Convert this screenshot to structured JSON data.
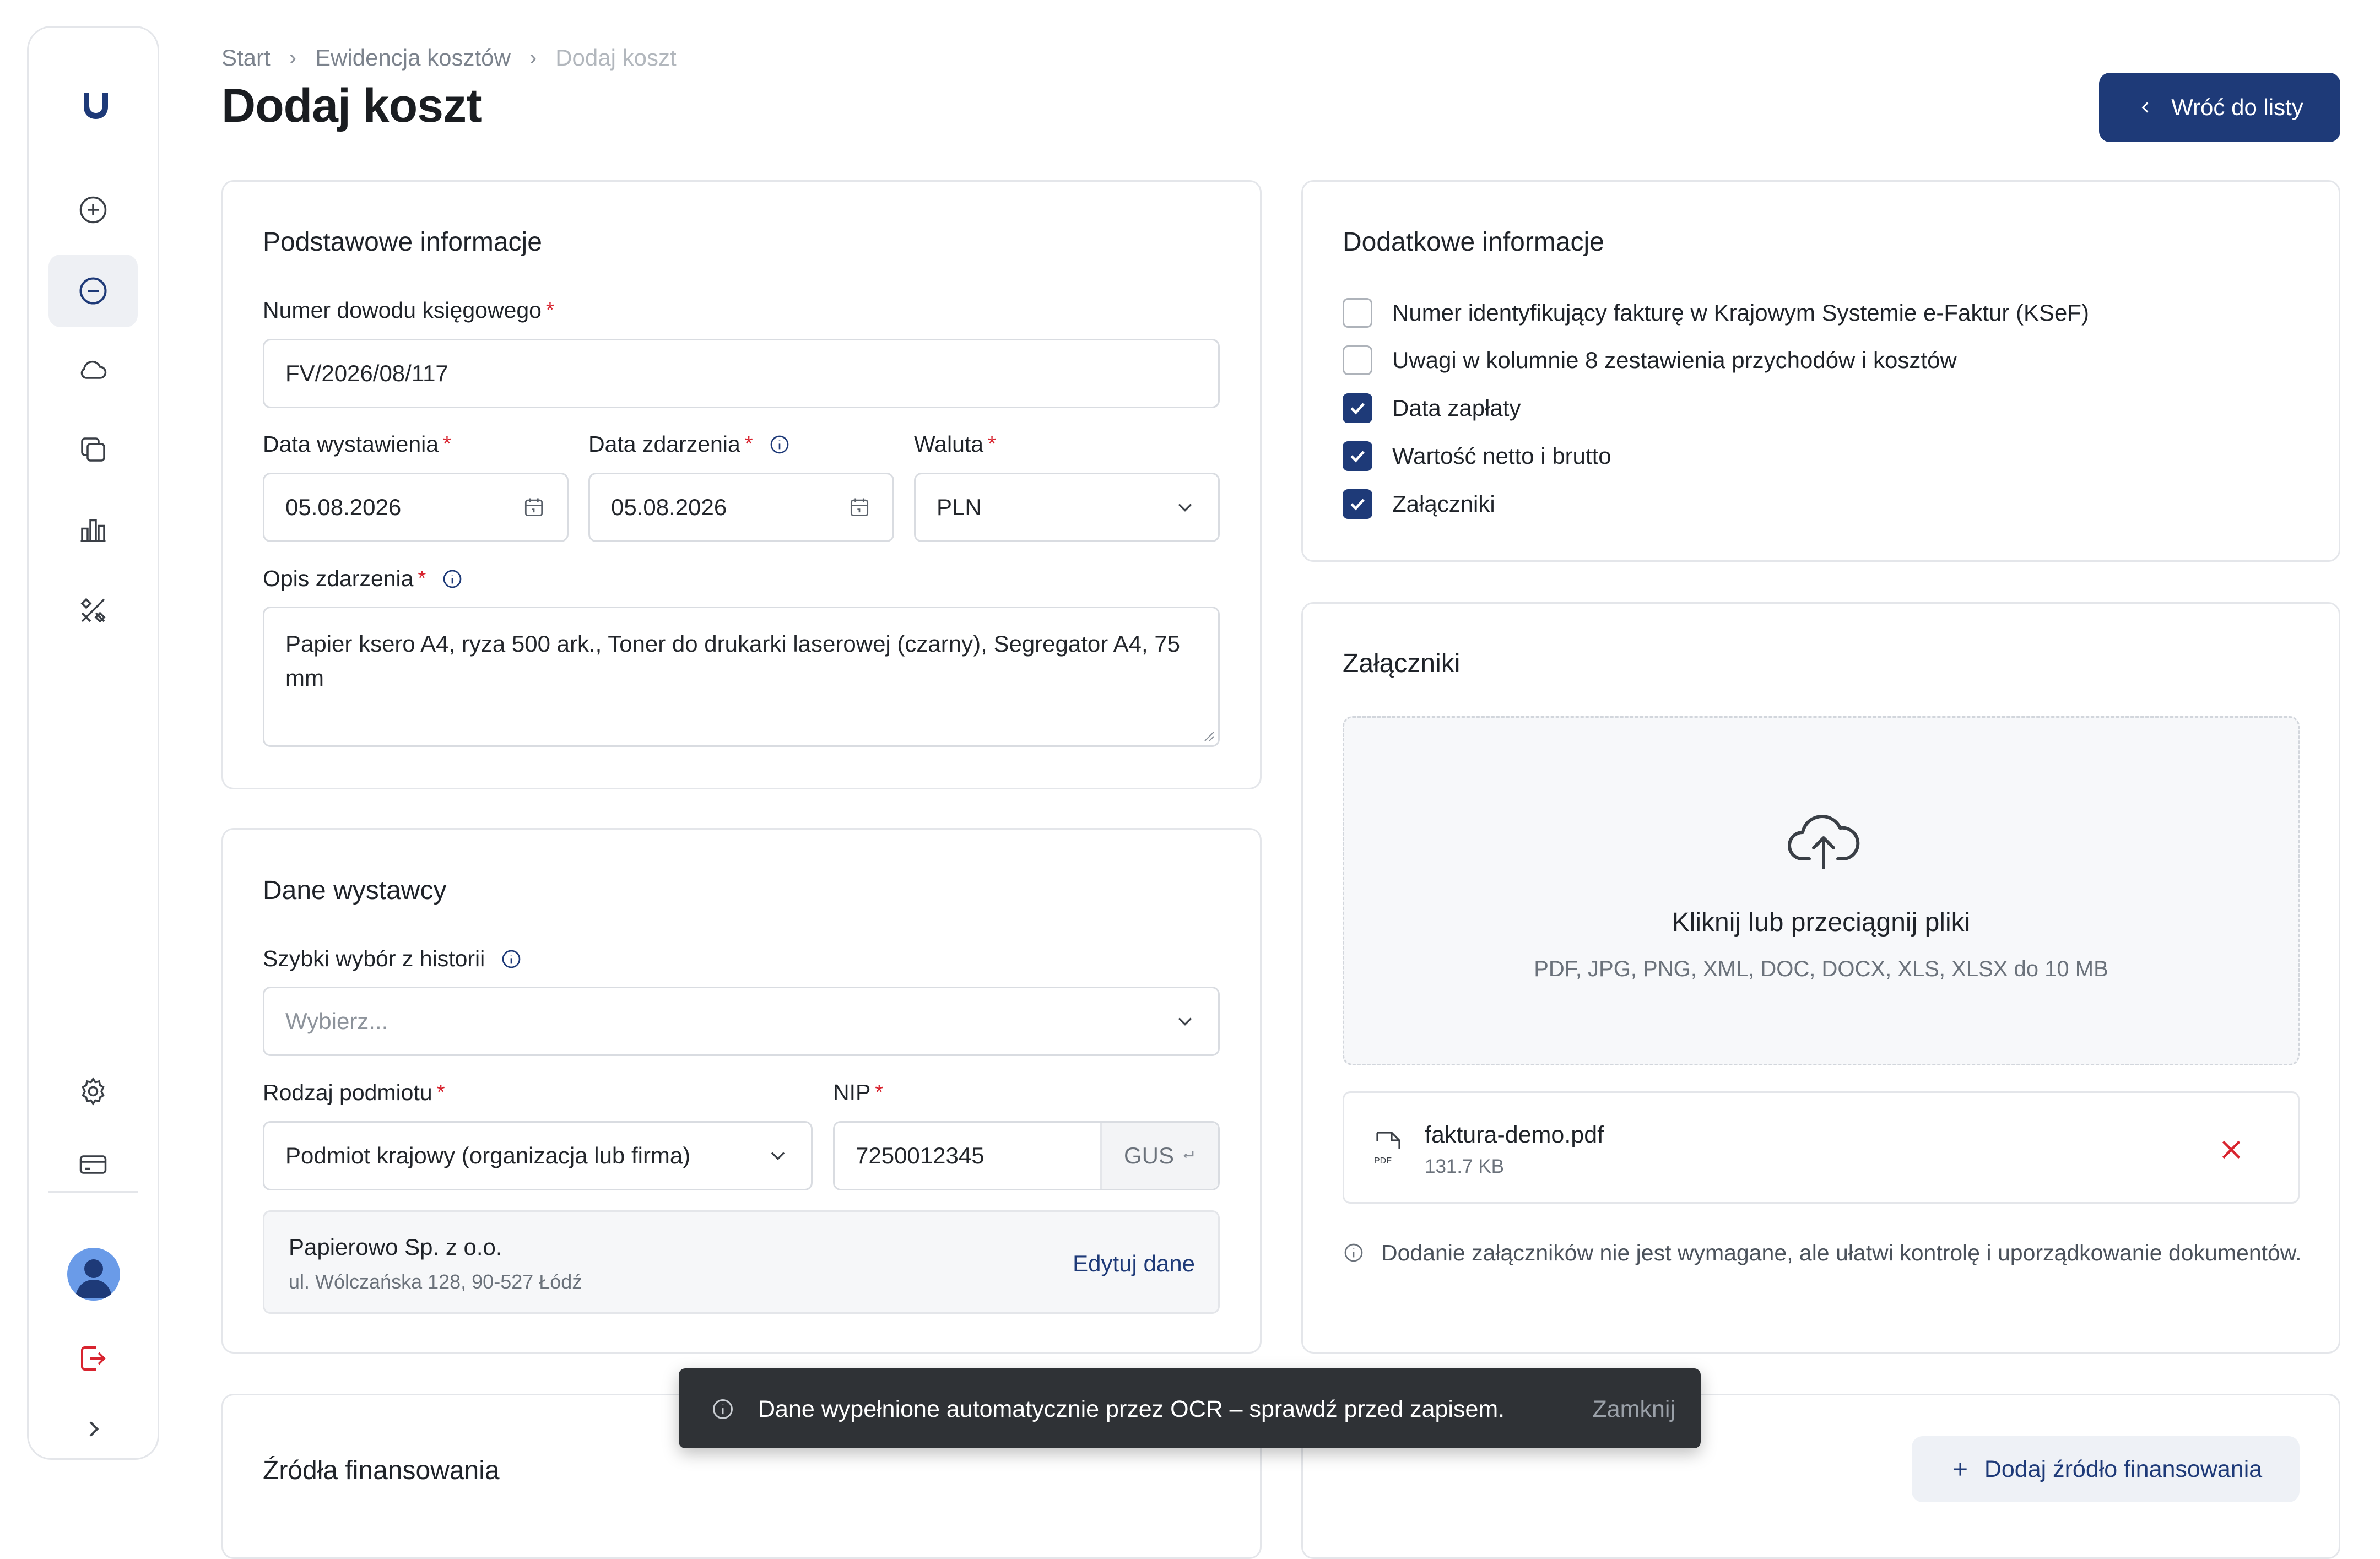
{
  "breadcrumb": {
    "items": [
      "Start",
      "Ewidencja kosztów"
    ],
    "current": "Dodaj koszt"
  },
  "page": {
    "title": "Dodaj koszt",
    "back_button": "Wróć do listy"
  },
  "basic_info": {
    "title": "Podstawowe informacje",
    "doc_number_label": "Numer dowodu księgowego",
    "doc_number_value": "FV/2026/08/117",
    "issue_date_label": "Data wystawienia",
    "issue_date_value": "05.08.2026",
    "event_date_label": "Data zdarzenia",
    "event_date_value": "05.08.2026",
    "currency_label": "Waluta",
    "currency_value": "PLN",
    "description_label": "Opis zdarzenia",
    "description_value": "Papier ksero A4, ryza 500 ark., Toner do drukarki laserowej (czarny), Segregator A4, 75 mm",
    "required_mark": "*"
  },
  "issuer": {
    "title": "Dane wystawcy",
    "history_label": "Szybki wybór z historii",
    "history_placeholder": "Wybierz...",
    "entity_type_label": "Rodzaj podmiotu",
    "entity_type_value": "Podmiot krajowy (organizacja lub firma)",
    "nip_label": "NIP",
    "nip_value": "7250012345",
    "gus_label": "GUS",
    "gus_icon": "enter-icon",
    "company_name": "Papierowo Sp. z o.o.",
    "company_address": "ul. Wólczańska 128, 90-527 Łódź",
    "edit_link": "Edytuj dane"
  },
  "additional_info": {
    "title": "Dodatkowe informacje",
    "options": [
      {
        "label": "Numer identyfikujący fakturę w Krajowym Systemie e-Faktur (KSeF)",
        "checked": false
      },
      {
        "label": "Uwagi w kolumnie 8 zestawienia przychodów i kosztów",
        "checked": false
      },
      {
        "label": "Data zapłaty",
        "checked": true
      },
      {
        "label": "Wartość netto i brutto",
        "checked": true
      },
      {
        "label": "Załączniki",
        "checked": true
      }
    ]
  },
  "attachments": {
    "title": "Załączniki",
    "dropzone_title": "Kliknij lub przeciągnij pliki",
    "dropzone_subtitle": "PDF, JPG, PNG, XML, DOC, DOCX, XLS, XLSX do 10 MB",
    "file": {
      "name": "faktura-demo.pdf",
      "size": "131.7 KB",
      "type_badge": "PDF"
    },
    "note": "Dodanie załączników nie jest wymagane, ale ułatwi kontrolę i uporządkowanie dokumentów."
  },
  "funding": {
    "title": "Źródła finansowania",
    "add_button": "Dodaj źródło finansowania"
  },
  "toast": {
    "message": "Dane wypełnione automatycznie przez OCR – sprawdź przed zapisem.",
    "close": "Zamknij"
  },
  "sidebar": {
    "items": [
      {
        "icon": "plus-circle-icon",
        "active": false
      },
      {
        "icon": "minus-circle-icon",
        "active": true
      },
      {
        "icon": "cloud-icon",
        "active": false
      },
      {
        "icon": "copy-icon",
        "active": false
      },
      {
        "icon": "bar-chart-icon",
        "active": false
      },
      {
        "icon": "tools-icon",
        "active": false
      }
    ],
    "bottom": [
      "gear-icon",
      "credit-card-icon",
      "avatar",
      "logout-icon",
      "chevron-right-icon"
    ]
  },
  "colors": {
    "primary": "#1e3a78",
    "required": "#d8242f",
    "remove": "#d8242f",
    "toast_bg": "#2f3236"
  }
}
